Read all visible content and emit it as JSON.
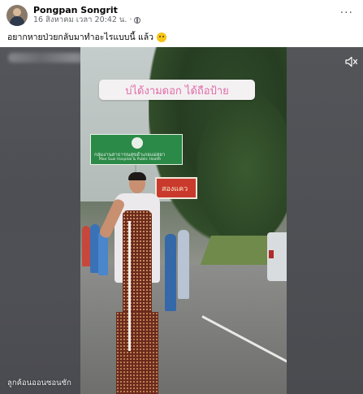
{
  "post": {
    "author": "Pongpan Songrit",
    "timestamp": "16 สิงหาคม เวลา 20:42 น.",
    "separator": "·",
    "privacy_icon": "globe-icon",
    "more_label": "···",
    "caption": "อยากหายป่วยกลับมาทำอะไรแบบนี้ แล้ว",
    "caption_emoji": "smiling-face-emoji"
  },
  "video": {
    "overlay_text": "บ่ได้งามดอก ได้ถือป้าย",
    "green_sign_line1": "กลุ่มงานสาธารณสุขอำเภอแม่สุยา",
    "green_sign_line2": "Mae Suai Hospital & Public Health",
    "red_sign_text": "สองแคว",
    "watermark": "ลูกค้อนออนซอนซัก",
    "mute_icon": "speaker-muted-icon"
  }
}
